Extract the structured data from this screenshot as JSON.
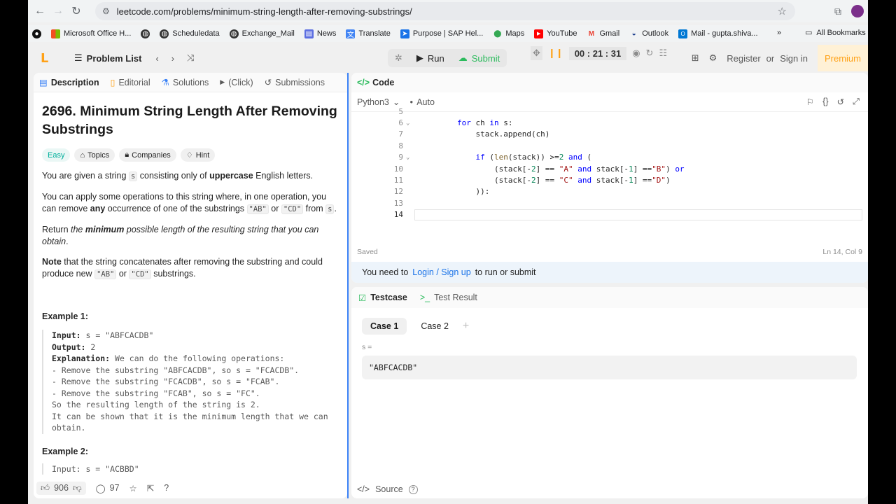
{
  "browser": {
    "url": "leetcode.com/problems/minimum-string-length-after-removing-substrings/",
    "bookmarks": [
      {
        "label": "Microsoft Office H...",
        "icon": "microsoft-icon",
        "color": "#f25022"
      },
      {
        "label": "Scheduledata",
        "icon": "globe-icon",
        "color": "#333333"
      },
      {
        "label": "Exchange_Mail",
        "icon": "globe-icon",
        "color": "#333333"
      },
      {
        "label": "News",
        "icon": "news-icon",
        "color": "#5b6ee1"
      },
      {
        "label": "Translate",
        "icon": "translate-icon",
        "color": "#4285f4"
      },
      {
        "label": "Purpose | SAP Hel...",
        "icon": "sap-icon",
        "color": "#1a73e8"
      },
      {
        "label": "Maps",
        "icon": "maps-icon",
        "color": "#34a853"
      },
      {
        "label": "YouTube",
        "icon": "youtube-icon",
        "color": "#ff0000"
      },
      {
        "label": "Gmail",
        "icon": "gmail-icon",
        "color": "#ea4335"
      },
      {
        "label": "Outlook",
        "icon": "tata-icon",
        "color": "#1a3c8c"
      },
      {
        "label": "Mail - gupta.shiva...",
        "icon": "outlook-icon",
        "color": "#0078d4"
      }
    ],
    "more_label": "»",
    "all_bookmarks_label": "All Bookmarks"
  },
  "header": {
    "problem_list_label": "Problem List",
    "run_label": "Run",
    "submit_label": "Submit",
    "timer": "00 : 21 : 31",
    "register_label": "Register",
    "or_label": "or",
    "signin_label": "Sign in",
    "premium_label": "Premium"
  },
  "left_tabs": {
    "description": "Description",
    "editorial": "Editorial",
    "solutions": "Solutions",
    "click": "(Click)",
    "submissions": "Submissions"
  },
  "problem": {
    "title": "2696. Minimum String Length After Removing Substrings",
    "tags": {
      "difficulty": "Easy",
      "topics": "Topics",
      "companies": "Companies",
      "hint": "Hint"
    },
    "p1_a": "You are given a string ",
    "p1_code": "s",
    "p1_b": " consisting only of ",
    "p1_bold": "uppercase",
    "p1_c": " English letters.",
    "p2_a": "You can apply some operations to this string where, in one operation, you can remove ",
    "p2_bold": "any",
    "p2_b": " occurrence of one of the substrings ",
    "p2_code1": "\"AB\"",
    "p2_or": " or ",
    "p2_code2": "\"CD\"",
    "p2_c": " from ",
    "p2_code3": "s",
    "p2_d": ".",
    "p3_a": "Return ",
    "p3_b": "the ",
    "p3_bold": "minimum",
    "p3_c": " possible length of the resulting string that you can obtain",
    "p3_d": ".",
    "p4_bold": "Note",
    "p4_a": " that the string concatenates after removing the substring and could produce new ",
    "p4_code1": "\"AB\"",
    "p4_or": " or ",
    "p4_code2": "\"CD\"",
    "p4_b": " substrings.",
    "example1_title": "Example 1:",
    "example1": {
      "input_label": "Input:",
      "input": " s = \"ABFCACDB\"",
      "output_label": "Output:",
      "output": " 2",
      "explanation_label": "Explanation:",
      "explanation": " We can do the following operations:",
      "lines": [
        "- Remove the substring \"ABFCACDB\", so s = \"FCACDB\".",
        "- Remove the substring \"FCACDB\", so s = \"FCAB\".",
        "- Remove the substring \"FCAB\", so s = \"FC\".",
        "So the resulting length of the string is 2.",
        "It can be shown that it is the minimum length that we can",
        "obtain."
      ]
    },
    "example2_title": "Example 2:",
    "example2_partial": "Input: s = \"ACBBD\""
  },
  "footer": {
    "likes": "906",
    "comments": "97"
  },
  "code_panel": {
    "tab_label": "Code",
    "language": "Python3",
    "auto_label": "Auto",
    "saved_label": "Saved",
    "cursor_pos": "Ln 14, Col 9",
    "login_text_a": "You need to",
    "login_link": "Login / Sign up",
    "login_text_b": "to run or submit",
    "lines": [
      {
        "n": "5",
        "code": ""
      },
      {
        "n": "6",
        "code": "        for ch in s:",
        "fold": true
      },
      {
        "n": "7",
        "code": "            stack.append(ch)"
      },
      {
        "n": "8",
        "code": ""
      },
      {
        "n": "9",
        "code": "            if (len(stack)) >=2 and (",
        "fold": true
      },
      {
        "n": "10",
        "code": "                (stack[-2] == \"A\" and stack[-1] ==\"B\") or"
      },
      {
        "n": "11",
        "code": "                (stack[-2] == \"C\" and stack[-1] ==\"D\")"
      },
      {
        "n": "12",
        "code": "            )):"
      },
      {
        "n": "13",
        "code": ""
      },
      {
        "n": "14",
        "code": ""
      }
    ]
  },
  "test_panel": {
    "testcase_label": "Testcase",
    "result_label": "Test Result",
    "case1": "Case 1",
    "case2": "Case 2",
    "add": "+",
    "var_label": "s =",
    "var_value": "\"ABFCACDB\"",
    "source_label": "Source"
  }
}
